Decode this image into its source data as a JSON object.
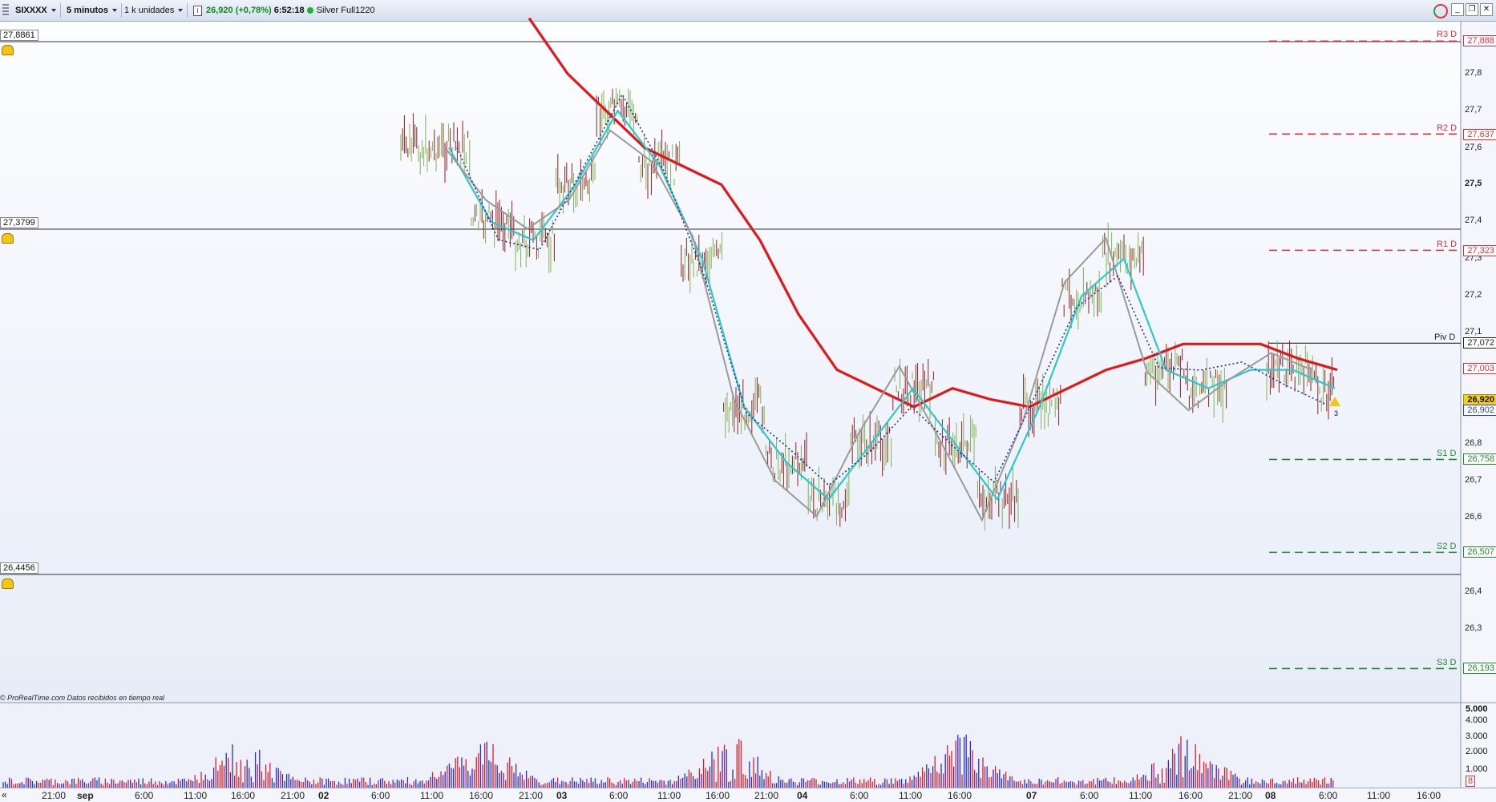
{
  "toolbar": {
    "symbol": "SIXXXX",
    "timeframe": "5 minutos",
    "units": "1 k unidades",
    "info_icon": "info-icon",
    "price_change": "26,920 (+0,78%)",
    "time": "6:52:18",
    "account": "Silver Full1220"
  },
  "price_lines": [
    {
      "label": "27,8861"
    },
    {
      "label": "27,3799"
    },
    {
      "label": "26,4456"
    }
  ],
  "y_axis": {
    "ticks": [
      "27,8",
      "27,7",
      "27,6",
      "27,5",
      "27,4",
      "27,3",
      "27,2",
      "27,1",
      "26,8",
      "26,7",
      "26,6",
      "26,4",
      "26,3"
    ]
  },
  "pivots": [
    {
      "name": "R3 D",
      "value": "27,888",
      "color": "#d9333a"
    },
    {
      "name": "R2 D",
      "value": "27,637",
      "color": "#d9333a"
    },
    {
      "name": "R1 D",
      "value": "27,323",
      "color": "#d9333a"
    },
    {
      "name": "Piv D",
      "value": "27,072",
      "color": "#222222"
    },
    {
      "name": "S1 D",
      "value": "26,758",
      "color": "#1f8a2c"
    },
    {
      "name": "S2 D",
      "value": "26,507",
      "color": "#1f8a2c"
    },
    {
      "name": "S3 D",
      "value": "26,193",
      "color": "#1f8a2c"
    }
  ],
  "price_tags": [
    {
      "value": "27,003",
      "color": "#d9333a"
    },
    {
      "value": "26,920",
      "color": "#b08a00"
    },
    {
      "value": "26,902",
      "color": "#2a3fb5"
    }
  ],
  "footer": "© ProRealTime.com  Datos recibidos en tiempo real",
  "volume_axis": {
    "ticks": [
      "5.000",
      "4.000",
      "3.000",
      "2.000",
      "1.000",
      "8"
    ]
  },
  "x_axis": {
    "labels": [
      "21:00",
      "sep",
      "6:00",
      "11:00",
      "16:00",
      "21:00",
      "02",
      "6:00",
      "11:00",
      "16:00",
      "21:00",
      "03",
      "6:00",
      "11:00",
      "16:00",
      "21:00",
      "04",
      "6:00",
      "11:00",
      "16:00",
      "07",
      "6:00",
      "11:00",
      "16:00",
      "21:00",
      "08",
      "6:00",
      "11:00",
      "16:00"
    ]
  },
  "colors": {
    "ma_red": "#e01818",
    "ma_cyan": "#2ec8c8",
    "ma_grey": "#9a9a9a",
    "dotted_blue": "#2430a8"
  },
  "bell_counter": "3",
  "chart_data": {
    "type": "line",
    "title": "",
    "series": [
      {
        "values": [
          27.95,
          27.8,
          27.7,
          27.6,
          27.55,
          27.5,
          27.35,
          27.15,
          27.0,
          26.95,
          26.9,
          26.95,
          26.92,
          26.9,
          26.95,
          27.0,
          27.03,
          27.07,
          27.07,
          27.07,
          27.03,
          27.0
        ]
      },
      {
        "values": [
          27.6,
          27.4,
          27.35,
          27.5,
          27.7,
          27.55,
          27.3,
          26.9,
          26.75,
          26.65,
          26.8,
          26.95,
          26.8,
          26.65,
          26.9,
          27.2,
          27.3,
          27.0,
          26.95,
          27.0,
          27.0,
          26.95
        ]
      }
    ]
  }
}
